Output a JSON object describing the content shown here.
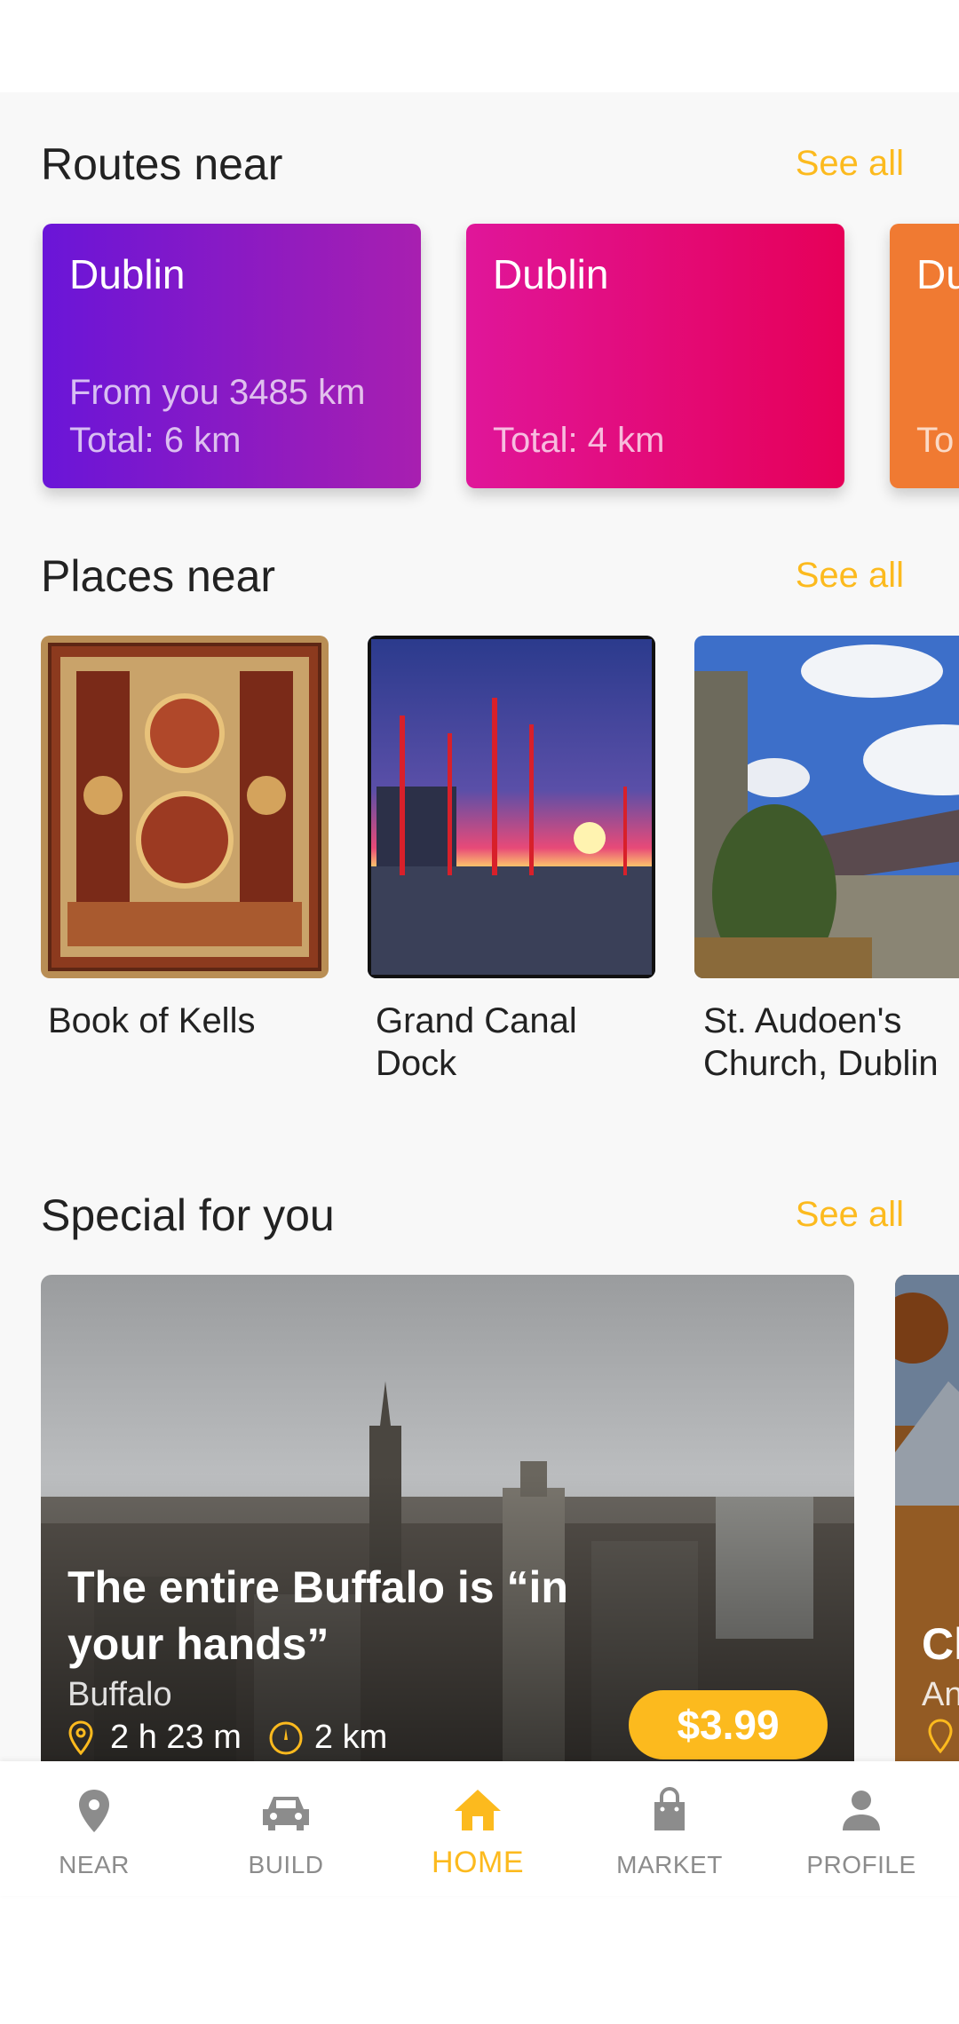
{
  "routes_section": {
    "title": "Routes near",
    "see_all": "See all",
    "cards": [
      {
        "city": "Dublin",
        "from": "From you 3485 km",
        "total": "Total: 6 km"
      },
      {
        "city": "Dublin",
        "from": "",
        "total": "Total: 4 km"
      },
      {
        "city": "Du",
        "from": "",
        "total": "To"
      }
    ]
  },
  "places_section": {
    "title": "Places near",
    "see_all": "See all",
    "items": [
      {
        "name": "Book of Kells"
      },
      {
        "name": "Grand Canal Dock"
      },
      {
        "name": "St. Audoen's Church, Dublin"
      }
    ]
  },
  "special_section": {
    "title": "Special for you",
    "see_all": "See all",
    "cards": [
      {
        "title": "The entire Buffalo is “in your hands”",
        "city": "Buffalo",
        "duration": "2 h 23 m",
        "distance": "2 km",
        "price": "$3.99"
      },
      {
        "title": "Cl",
        "city": "An"
      }
    ]
  },
  "bottom_nav": {
    "items": [
      {
        "label": "NEAR",
        "icon": "location-pin-icon"
      },
      {
        "label": "BUILD",
        "icon": "car-icon"
      },
      {
        "label": "HOME",
        "icon": "home-icon",
        "active": true
      },
      {
        "label": "MARKET",
        "icon": "shopping-bag-icon"
      },
      {
        "label": "PROFILE",
        "icon": "person-icon"
      }
    ]
  },
  "colors": {
    "accent": "#fcba1e",
    "route1_gradient_start": "#6a15d8",
    "route1_gradient_end": "#a81fb0",
    "route2_gradient_start": "#e0169a",
    "route2_gradient_end": "#e60058",
    "route3": "#f07a32"
  }
}
